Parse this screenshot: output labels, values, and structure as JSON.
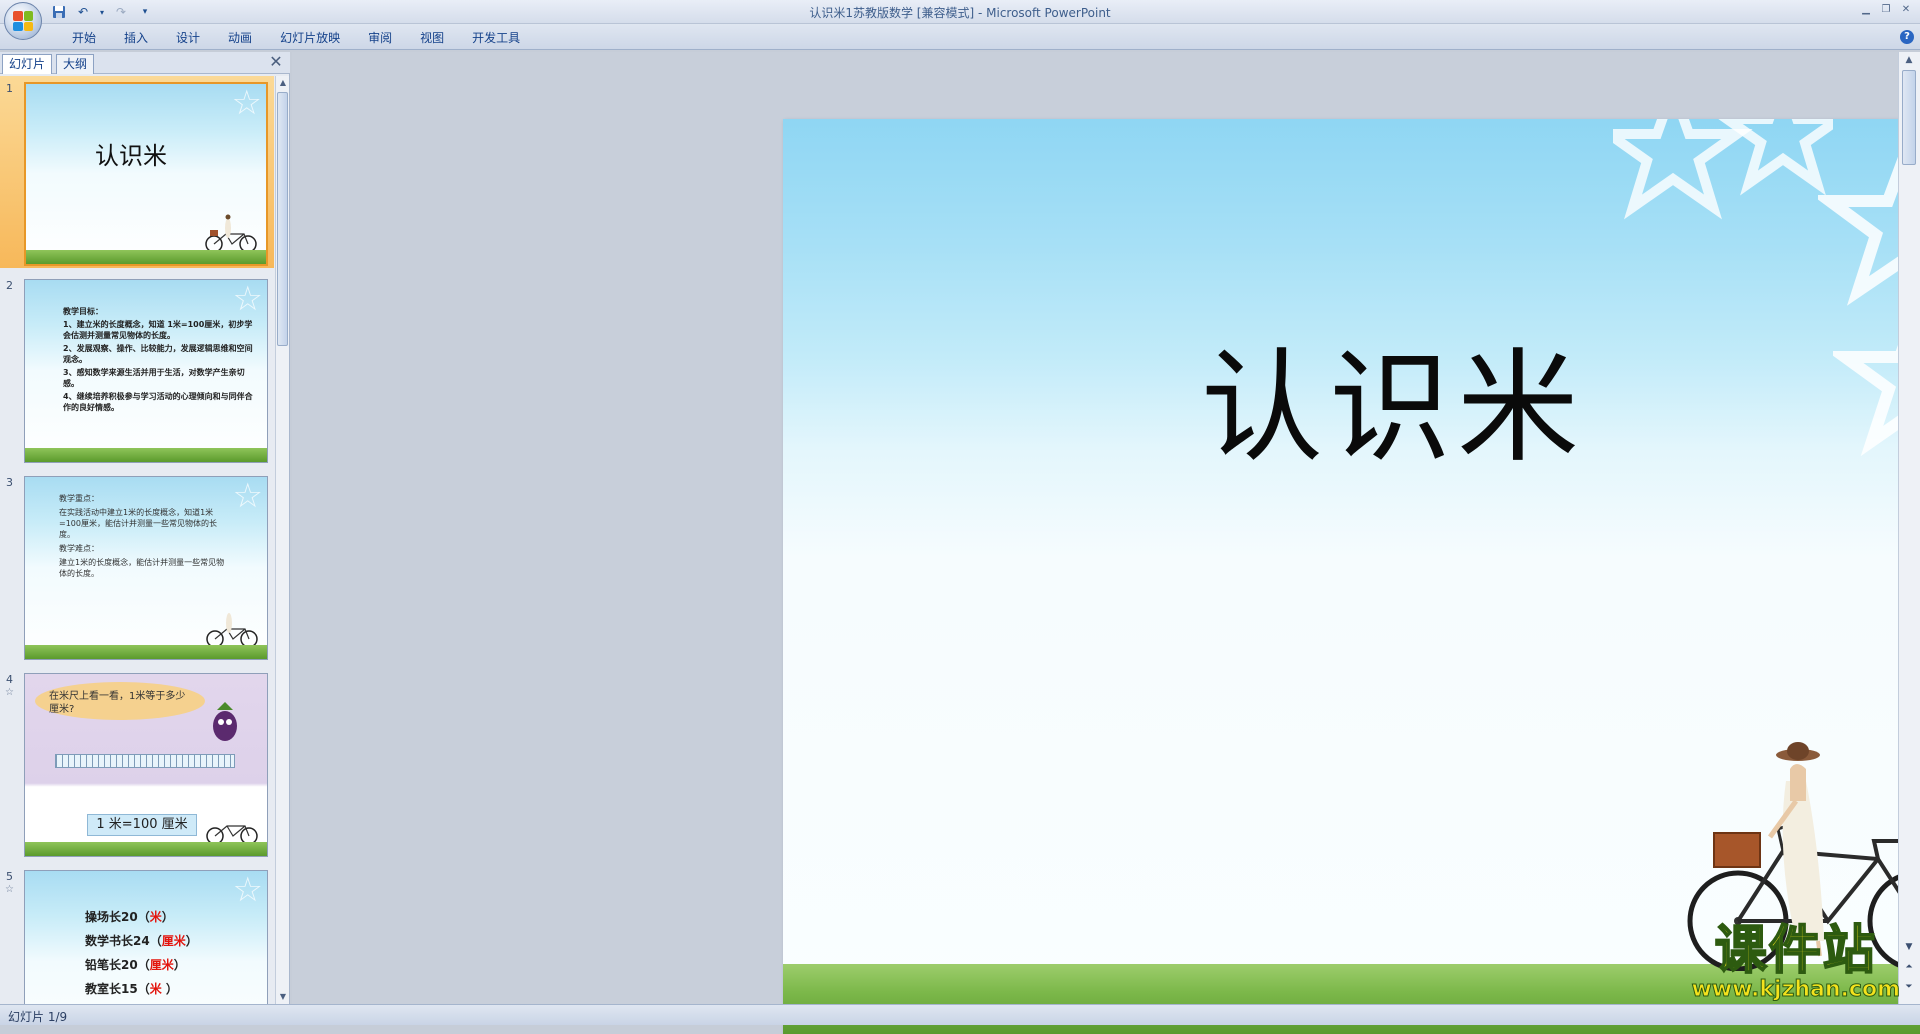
{
  "window": {
    "title": "认识米1苏教版数学 [兼容模式] - Microsoft PowerPoint"
  },
  "ribbon": {
    "tabs": [
      "开始",
      "插入",
      "设计",
      "动画",
      "幻灯片放映",
      "审阅",
      "视图",
      "开发工具"
    ]
  },
  "pane": {
    "tab_slides": "幻灯片",
    "tab_outline": "大纲"
  },
  "thumbnails": {
    "s1": {
      "num": "1",
      "title": "认识米"
    },
    "s2": {
      "num": "2",
      "lines": [
        "教学目标：",
        "1、建立米的长度概念，知道  1米=100厘米，初步学会估测并测量常见物体的长度。",
        "2、发展观察、操作、比较能力，发展逻辑思维和空间观念。",
        "3、感知数学来源生活并用于生活，对数学产生亲切感。",
        "4、继续培养积极参与学习活动的心理倾向和与同伴合作的良好情感。"
      ]
    },
    "s3": {
      "num": "3",
      "lines": [
        "教学重点：",
        "在实践活动中建立1米的长度概念，知道1米=100厘米，能估计并测量一些常见物体的长度。",
        "教学难点：",
        "建立1米的长度概念，能估计并测量一些常见物体的长度。"
      ]
    },
    "s4": {
      "num": "4",
      "bubble": "在米尺上看一看，1米等于多少厘米?",
      "label": "1 米=100 厘米"
    },
    "s5": {
      "num": "5",
      "items": [
        {
          "prefix": "操场长20（",
          "answer": "米",
          "suffix": "）"
        },
        {
          "prefix": "数学书长24（",
          "answer": "厘米",
          "suffix": "）"
        },
        {
          "prefix": "铅笔长20（",
          "answer": "厘米",
          "suffix": "）"
        },
        {
          "prefix": "教室长15（",
          "answer": "米",
          "suffix": "  ）"
        }
      ]
    }
  },
  "slide": {
    "title": "认识米"
  },
  "watermark": {
    "cn": "课件站",
    "url": "www.kjzhan.com"
  },
  "status": {
    "slide_info": "幻灯片 1/9"
  },
  "colors": {
    "accent_red": "#e3140d",
    "selected_thumb": "#f7b85a",
    "watermark_yellow": "#f4e21d"
  }
}
